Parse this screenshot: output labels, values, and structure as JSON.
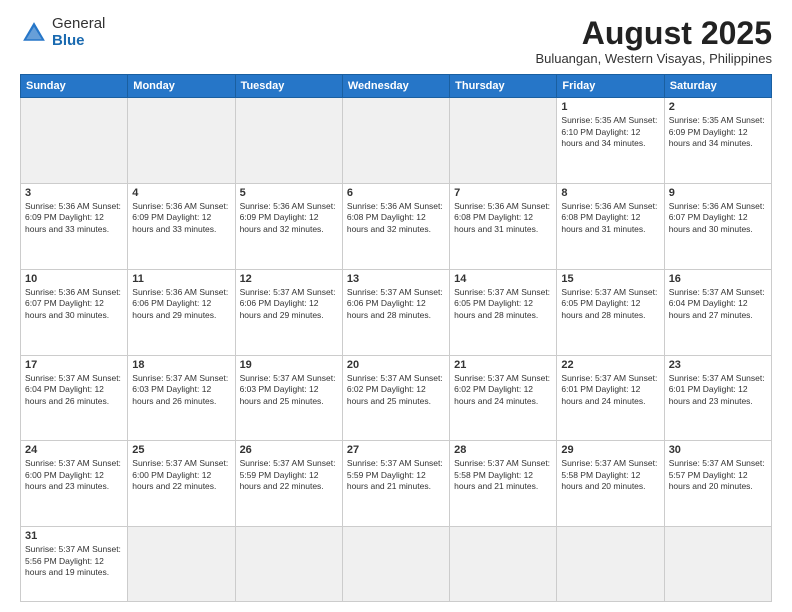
{
  "header": {
    "logo_general": "General",
    "logo_blue": "Blue",
    "month_year": "August 2025",
    "location": "Buluangan, Western Visayas, Philippines"
  },
  "days_of_week": [
    "Sunday",
    "Monday",
    "Tuesday",
    "Wednesday",
    "Thursday",
    "Friday",
    "Saturday"
  ],
  "weeks": [
    [
      {
        "day": "",
        "info": "",
        "empty": true
      },
      {
        "day": "",
        "info": "",
        "empty": true
      },
      {
        "day": "",
        "info": "",
        "empty": true
      },
      {
        "day": "",
        "info": "",
        "empty": true
      },
      {
        "day": "",
        "info": "",
        "empty": true
      },
      {
        "day": "1",
        "info": "Sunrise: 5:35 AM\nSunset: 6:10 PM\nDaylight: 12 hours\nand 34 minutes."
      },
      {
        "day": "2",
        "info": "Sunrise: 5:35 AM\nSunset: 6:09 PM\nDaylight: 12 hours\nand 34 minutes."
      }
    ],
    [
      {
        "day": "3",
        "info": "Sunrise: 5:36 AM\nSunset: 6:09 PM\nDaylight: 12 hours\nand 33 minutes."
      },
      {
        "day": "4",
        "info": "Sunrise: 5:36 AM\nSunset: 6:09 PM\nDaylight: 12 hours\nand 33 minutes."
      },
      {
        "day": "5",
        "info": "Sunrise: 5:36 AM\nSunset: 6:09 PM\nDaylight: 12 hours\nand 32 minutes."
      },
      {
        "day": "6",
        "info": "Sunrise: 5:36 AM\nSunset: 6:08 PM\nDaylight: 12 hours\nand 32 minutes."
      },
      {
        "day": "7",
        "info": "Sunrise: 5:36 AM\nSunset: 6:08 PM\nDaylight: 12 hours\nand 31 minutes."
      },
      {
        "day": "8",
        "info": "Sunrise: 5:36 AM\nSunset: 6:08 PM\nDaylight: 12 hours\nand 31 minutes."
      },
      {
        "day": "9",
        "info": "Sunrise: 5:36 AM\nSunset: 6:07 PM\nDaylight: 12 hours\nand 30 minutes."
      }
    ],
    [
      {
        "day": "10",
        "info": "Sunrise: 5:36 AM\nSunset: 6:07 PM\nDaylight: 12 hours\nand 30 minutes."
      },
      {
        "day": "11",
        "info": "Sunrise: 5:36 AM\nSunset: 6:06 PM\nDaylight: 12 hours\nand 29 minutes."
      },
      {
        "day": "12",
        "info": "Sunrise: 5:37 AM\nSunset: 6:06 PM\nDaylight: 12 hours\nand 29 minutes."
      },
      {
        "day": "13",
        "info": "Sunrise: 5:37 AM\nSunset: 6:06 PM\nDaylight: 12 hours\nand 28 minutes."
      },
      {
        "day": "14",
        "info": "Sunrise: 5:37 AM\nSunset: 6:05 PM\nDaylight: 12 hours\nand 28 minutes."
      },
      {
        "day": "15",
        "info": "Sunrise: 5:37 AM\nSunset: 6:05 PM\nDaylight: 12 hours\nand 28 minutes."
      },
      {
        "day": "16",
        "info": "Sunrise: 5:37 AM\nSunset: 6:04 PM\nDaylight: 12 hours\nand 27 minutes."
      }
    ],
    [
      {
        "day": "17",
        "info": "Sunrise: 5:37 AM\nSunset: 6:04 PM\nDaylight: 12 hours\nand 26 minutes."
      },
      {
        "day": "18",
        "info": "Sunrise: 5:37 AM\nSunset: 6:03 PM\nDaylight: 12 hours\nand 26 minutes."
      },
      {
        "day": "19",
        "info": "Sunrise: 5:37 AM\nSunset: 6:03 PM\nDaylight: 12 hours\nand 25 minutes."
      },
      {
        "day": "20",
        "info": "Sunrise: 5:37 AM\nSunset: 6:02 PM\nDaylight: 12 hours\nand 25 minutes."
      },
      {
        "day": "21",
        "info": "Sunrise: 5:37 AM\nSunset: 6:02 PM\nDaylight: 12 hours\nand 24 minutes."
      },
      {
        "day": "22",
        "info": "Sunrise: 5:37 AM\nSunset: 6:01 PM\nDaylight: 12 hours\nand 24 minutes."
      },
      {
        "day": "23",
        "info": "Sunrise: 5:37 AM\nSunset: 6:01 PM\nDaylight: 12 hours\nand 23 minutes."
      }
    ],
    [
      {
        "day": "24",
        "info": "Sunrise: 5:37 AM\nSunset: 6:00 PM\nDaylight: 12 hours\nand 23 minutes."
      },
      {
        "day": "25",
        "info": "Sunrise: 5:37 AM\nSunset: 6:00 PM\nDaylight: 12 hours\nand 22 minutes."
      },
      {
        "day": "26",
        "info": "Sunrise: 5:37 AM\nSunset: 5:59 PM\nDaylight: 12 hours\nand 22 minutes."
      },
      {
        "day": "27",
        "info": "Sunrise: 5:37 AM\nSunset: 5:59 PM\nDaylight: 12 hours\nand 21 minutes."
      },
      {
        "day": "28",
        "info": "Sunrise: 5:37 AM\nSunset: 5:58 PM\nDaylight: 12 hours\nand 21 minutes."
      },
      {
        "day": "29",
        "info": "Sunrise: 5:37 AM\nSunset: 5:58 PM\nDaylight: 12 hours\nand 20 minutes."
      },
      {
        "day": "30",
        "info": "Sunrise: 5:37 AM\nSunset: 5:57 PM\nDaylight: 12 hours\nand 20 minutes."
      }
    ],
    [
      {
        "day": "31",
        "info": "Sunrise: 5:37 AM\nSunset: 5:56 PM\nDaylight: 12 hours\nand 19 minutes."
      },
      {
        "day": "",
        "info": "",
        "empty": true
      },
      {
        "day": "",
        "info": "",
        "empty": true
      },
      {
        "day": "",
        "info": "",
        "empty": true
      },
      {
        "day": "",
        "info": "",
        "empty": true
      },
      {
        "day": "",
        "info": "",
        "empty": true
      },
      {
        "day": "",
        "info": "",
        "empty": true
      }
    ]
  ]
}
